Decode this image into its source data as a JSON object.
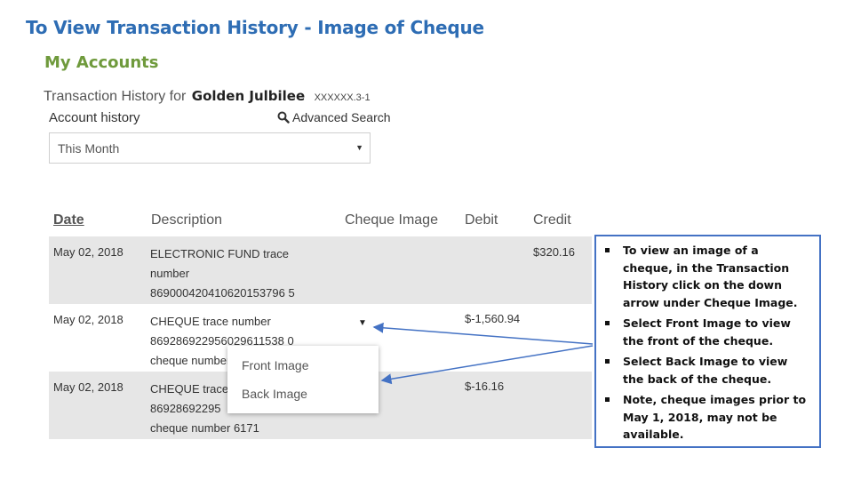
{
  "slide": {
    "title": "To View Transaction History - Image of Cheque"
  },
  "section": {
    "title": "My Accounts"
  },
  "history": {
    "prefix": "Transaction History for",
    "account_name": "Golden Julbilee",
    "account_number": "XXXXXX.3-1",
    "account_history_label": "Account history",
    "advanced_search_label": "Advanced Search",
    "period_selected": "This Month"
  },
  "table": {
    "headers": [
      "Date",
      "Description",
      "Cheque Image",
      "Debit",
      "Credit"
    ],
    "rows": [
      {
        "date": "May 02, 2018",
        "desc": [
          "ELECTRONIC FUND trace",
          "number",
          "869000420410620153796 5"
        ],
        "debit": "",
        "credit": "$320.16"
      },
      {
        "date": "May 02, 2018",
        "desc": [
          "CHEQUE trace number",
          "869286922956029611538 0",
          "cheque number"
        ],
        "debit": "$-1,560.94",
        "credit": ""
      },
      {
        "date": "May 02, 2018",
        "desc": [
          "CHEQUE trace",
          "86928692295",
          "cheque number 6171"
        ],
        "debit": "$-16.16",
        "credit": ""
      }
    ]
  },
  "dropdown": {
    "items": [
      "Front Image",
      "Back Image"
    ]
  },
  "callout": {
    "items": [
      "To view an image of a cheque, in the Transaction History click on the down arrow under Cheque Image.",
      "Select Front Image to view the front of the cheque.",
      "Select Back Image to view the back of the cheque.",
      "Note, cheque images prior to May 1, 2018, may not be available."
    ]
  },
  "colors": {
    "title": "#2e6db4",
    "section": "#6f9a3c",
    "callout_border": "#4472c4",
    "row_shade": "#e6e6e6"
  },
  "icons": {
    "search": "search-icon",
    "caret": "chevron-down-icon"
  }
}
